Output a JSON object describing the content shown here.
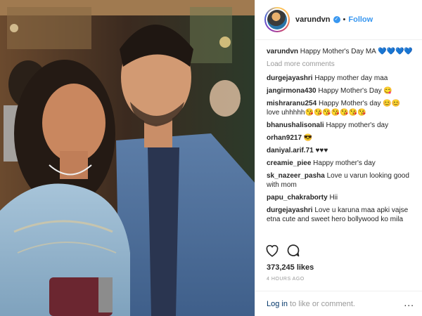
{
  "post": {
    "username": "varundvn",
    "follow_label": "Follow",
    "caption_user": "varundvn",
    "caption_text": "Happy Mother's Day MA 💙💙💙💙",
    "load_more": "Load more comments",
    "likes": "373,245 likes",
    "time_ago": "4 HOURS AGO",
    "login_link": "Log in",
    "login_suffix": " to like or comment.",
    "more_options": "..."
  },
  "comments": [
    {
      "user": "durgejayashri",
      "text": "Happy mother day maa"
    },
    {
      "user": "jangirmona430",
      "text": "Happy Mother's Day 😋"
    },
    {
      "user": "mishraranu254",
      "text": "Happy Mother's day 😊😊 love uhhhhh😘😘😘😘😘😘😘"
    },
    {
      "user": "bhanushalisonali",
      "text": "Happy mother's day"
    },
    {
      "user": "orhan9217",
      "text": "😎"
    },
    {
      "user": "daniyal.arif.71",
      "text": "♥♥♥"
    },
    {
      "user": "creamie_piee",
      "text": "Happy mother's day"
    },
    {
      "user": "sk_nazeer_pasha",
      "text": "Love u varun looking good with mom"
    },
    {
      "user": "papu_chakraborty",
      "text": "Hii"
    },
    {
      "user": "durgejayashri",
      "text": "Love u karuna maa apki vajse etna cute and sweet hero bollywood ko mila"
    }
  ],
  "colors": {
    "link": "#3897f0",
    "muted": "#999999",
    "text": "#262626"
  },
  "icons": {
    "like": "heart-icon",
    "comment": "comment-icon",
    "verified": "verified-badge-icon",
    "more": "more-options-icon"
  }
}
